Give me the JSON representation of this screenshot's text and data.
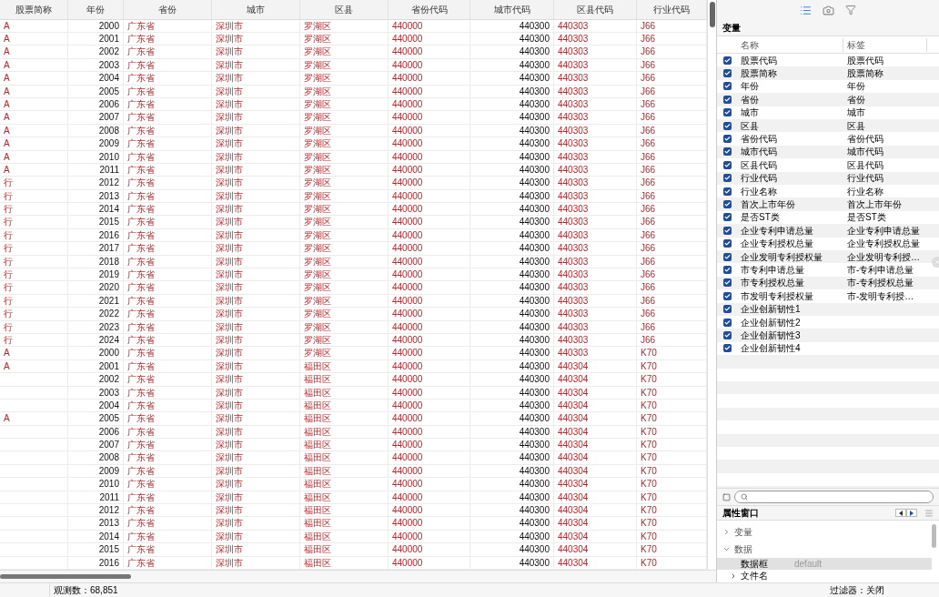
{
  "table": {
    "columns": [
      {
        "label": "股票简称",
        "kind": "string"
      },
      {
        "label": "年份",
        "kind": "numeric"
      },
      {
        "label": "省份",
        "kind": "string"
      },
      {
        "label": "城市",
        "kind": "string"
      },
      {
        "label": "区县",
        "kind": "string"
      },
      {
        "label": "省份代码",
        "kind": "string"
      },
      {
        "label": "城市代码",
        "kind": "numeric"
      },
      {
        "label": "区县代码",
        "kind": "string"
      },
      {
        "label": "行业代码",
        "kind": "string"
      }
    ],
    "rows": [
      [
        "A",
        "2000",
        "广东省",
        "深圳市",
        "罗湖区",
        "440000",
        "440300",
        "440303",
        "J66"
      ],
      [
        "A",
        "2001",
        "广东省",
        "深圳市",
        "罗湖区",
        "440000",
        "440300",
        "440303",
        "J66"
      ],
      [
        "A",
        "2002",
        "广东省",
        "深圳市",
        "罗湖区",
        "440000",
        "440300",
        "440303",
        "J66"
      ],
      [
        "A",
        "2003",
        "广东省",
        "深圳市",
        "罗湖区",
        "440000",
        "440300",
        "440303",
        "J66"
      ],
      [
        "A",
        "2004",
        "广东省",
        "深圳市",
        "罗湖区",
        "440000",
        "440300",
        "440303",
        "J66"
      ],
      [
        "A",
        "2005",
        "广东省",
        "深圳市",
        "罗湖区",
        "440000",
        "440300",
        "440303",
        "J66"
      ],
      [
        "A",
        "2006",
        "广东省",
        "深圳市",
        "罗湖区",
        "440000",
        "440300",
        "440303",
        "J66"
      ],
      [
        "A",
        "2007",
        "广东省",
        "深圳市",
        "罗湖区",
        "440000",
        "440300",
        "440303",
        "J66"
      ],
      [
        "A",
        "2008",
        "广东省",
        "深圳市",
        "罗湖区",
        "440000",
        "440300",
        "440303",
        "J66"
      ],
      [
        "A",
        "2009",
        "广东省",
        "深圳市",
        "罗湖区",
        "440000",
        "440300",
        "440303",
        "J66"
      ],
      [
        "A",
        "2010",
        "广东省",
        "深圳市",
        "罗湖区",
        "440000",
        "440300",
        "440303",
        "J66"
      ],
      [
        "A",
        "2011",
        "广东省",
        "深圳市",
        "罗湖区",
        "440000",
        "440300",
        "440303",
        "J66"
      ],
      [
        "行",
        "2012",
        "广东省",
        "深圳市",
        "罗湖区",
        "440000",
        "440300",
        "440303",
        "J66"
      ],
      [
        "行",
        "2013",
        "广东省",
        "深圳市",
        "罗湖区",
        "440000",
        "440300",
        "440303",
        "J66"
      ],
      [
        "行",
        "2014",
        "广东省",
        "深圳市",
        "罗湖区",
        "440000",
        "440300",
        "440303",
        "J66"
      ],
      [
        "行",
        "2015",
        "广东省",
        "深圳市",
        "罗湖区",
        "440000",
        "440300",
        "440303",
        "J66"
      ],
      [
        "行",
        "2016",
        "广东省",
        "深圳市",
        "罗湖区",
        "440000",
        "440300",
        "440303",
        "J66"
      ],
      [
        "行",
        "2017",
        "广东省",
        "深圳市",
        "罗湖区",
        "440000",
        "440300",
        "440303",
        "J66"
      ],
      [
        "行",
        "2018",
        "广东省",
        "深圳市",
        "罗湖区",
        "440000",
        "440300",
        "440303",
        "J66"
      ],
      [
        "行",
        "2019",
        "广东省",
        "深圳市",
        "罗湖区",
        "440000",
        "440300",
        "440303",
        "J66"
      ],
      [
        "行",
        "2020",
        "广东省",
        "深圳市",
        "罗湖区",
        "440000",
        "440300",
        "440303",
        "J66"
      ],
      [
        "行",
        "2021",
        "广东省",
        "深圳市",
        "罗湖区",
        "440000",
        "440300",
        "440303",
        "J66"
      ],
      [
        "行",
        "2022",
        "广东省",
        "深圳市",
        "罗湖区",
        "440000",
        "440300",
        "440303",
        "J66"
      ],
      [
        "行",
        "2023",
        "广东省",
        "深圳市",
        "罗湖区",
        "440000",
        "440300",
        "440303",
        "J66"
      ],
      [
        "行",
        "2024",
        "广东省",
        "深圳市",
        "罗湖区",
        "440000",
        "440300",
        "440303",
        "J66"
      ],
      [
        "A",
        "2000",
        "广东省",
        "深圳市",
        "罗湖区",
        "440000",
        "440300",
        "440303",
        "K70"
      ],
      [
        "A",
        "2001",
        "广东省",
        "深圳市",
        "福田区",
        "440000",
        "440300",
        "440304",
        "K70"
      ],
      [
        null,
        "2002",
        "广东省",
        "深圳市",
        "福田区",
        "440000",
        "440300",
        "440304",
        "K70"
      ],
      [
        null,
        "2003",
        "广东省",
        "深圳市",
        "福田区",
        "440000",
        "440300",
        "440304",
        "K70"
      ],
      [
        null,
        "2004",
        "广东省",
        "深圳市",
        "福田区",
        "440000",
        "440300",
        "440304",
        "K70"
      ],
      [
        "A",
        "2005",
        "广东省",
        "深圳市",
        "福田区",
        "440000",
        "440300",
        "440304",
        "K70"
      ],
      [
        null,
        "2006",
        "广东省",
        "深圳市",
        "福田区",
        "440000",
        "440300",
        "440304",
        "K70"
      ],
      [
        null,
        "2007",
        "广东省",
        "深圳市",
        "福田区",
        "440000",
        "440300",
        "440304",
        "K70"
      ],
      [
        null,
        "2008",
        "广东省",
        "深圳市",
        "福田区",
        "440000",
        "440300",
        "440304",
        "K70"
      ],
      [
        null,
        "2009",
        "广东省",
        "深圳市",
        "福田区",
        "440000",
        "440300",
        "440304",
        "K70"
      ],
      [
        null,
        "2010",
        "广东省",
        "深圳市",
        "福田区",
        "440000",
        "440300",
        "440304",
        "K70"
      ],
      [
        null,
        "2011",
        "广东省",
        "深圳市",
        "福田区",
        "440000",
        "440300",
        "440304",
        "K70"
      ],
      [
        null,
        "2012",
        "广东省",
        "深圳市",
        "福田区",
        "440000",
        "440300",
        "440304",
        "K70"
      ],
      [
        null,
        "2013",
        "广东省",
        "深圳市",
        "福田区",
        "440000",
        "440300",
        "440304",
        "K70"
      ],
      [
        null,
        "2014",
        "广东省",
        "深圳市",
        "福田区",
        "440000",
        "440300",
        "440304",
        "K70"
      ],
      [
        null,
        "2015",
        "广东省",
        "深圳市",
        "福田区",
        "440000",
        "440300",
        "440304",
        "K70"
      ],
      [
        null,
        "2016",
        "广东省",
        "深圳市",
        "福田区",
        "440000",
        "440300",
        "440304",
        "K70"
      ]
    ]
  },
  "variables": {
    "title": "变量",
    "columns": [
      "名称",
      "标签"
    ],
    "items": [
      {
        "name": "股票代码",
        "label": "股票代码",
        "checked": true
      },
      {
        "name": "股票简称",
        "label": "股票简称",
        "checked": true
      },
      {
        "name": "年份",
        "label": "年份",
        "checked": true
      },
      {
        "name": "省份",
        "label": "省份",
        "checked": true
      },
      {
        "name": "城市",
        "label": "城市",
        "checked": true
      },
      {
        "name": "区县",
        "label": "区县",
        "checked": true
      },
      {
        "name": "省份代码",
        "label": "省份代码",
        "checked": true
      },
      {
        "name": "城市代码",
        "label": "城市代码",
        "checked": true
      },
      {
        "name": "区县代码",
        "label": "区县代码",
        "checked": true
      },
      {
        "name": "行业代码",
        "label": "行业代码",
        "checked": true
      },
      {
        "name": "行业名称",
        "label": "行业名称",
        "checked": true
      },
      {
        "name": "首次上市年份",
        "label": "首次上市年份",
        "checked": true
      },
      {
        "name": "是否ST类",
        "label": "是否ST类",
        "checked": true
      },
      {
        "name": "企业专利申请总量",
        "label": "企业专利申请总量",
        "checked": true
      },
      {
        "name": "企业专利授权总量",
        "label": "企业专利授权总量",
        "checked": true
      },
      {
        "name": "企业发明专利授权量",
        "label": "企业发明专利授…",
        "checked": true
      },
      {
        "name": "市专利申请总量",
        "label": "市-专利申请总量",
        "checked": true
      },
      {
        "name": "市专利授权总量",
        "label": "市-专利授权总量",
        "checked": true
      },
      {
        "name": "市发明专利授权量",
        "label": "市-发明专利授…",
        "checked": true
      },
      {
        "name": "企业创新韧性1",
        "checked": true
      },
      {
        "name": "企业创新韧性2",
        "checked": true
      },
      {
        "name": "企业创新韧性3",
        "checked": true
      },
      {
        "name": "企业创新韧性4",
        "checked": true
      }
    ]
  },
  "properties": {
    "title": "属性窗口",
    "tree": [
      {
        "label": "变量",
        "expanded": false
      },
      {
        "label": "数据",
        "expanded": true,
        "children": [
          {
            "label": "数据框",
            "value": "default",
            "selected": true,
            "expandable": false
          },
          {
            "label": "文件名",
            "selected": false,
            "expandable": true
          }
        ]
      }
    ]
  },
  "status_bar": {
    "left": "观测数：68,851",
    "right": "过滤器：关闭"
  }
}
